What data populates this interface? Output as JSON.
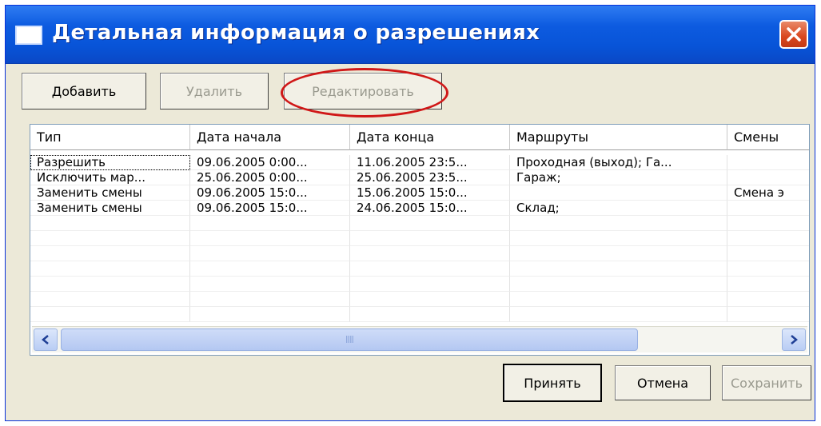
{
  "window": {
    "title": "Детальная информация о разрешениях",
    "accent_color": "#0854d8",
    "close_icon": "close-icon"
  },
  "toolbar": {
    "add_label": "Добавить",
    "delete_label": "Удалить",
    "edit_label": "Редактировать"
  },
  "grid": {
    "columns": [
      "Тип",
      "Дата начала",
      "Дата конца",
      "Маршруты",
      "Смены"
    ],
    "rows": [
      [
        "Разрешить",
        "09.06.2005 0:00...",
        "11.06.2005 23:5...",
        "Проходная (выход); Га...",
        ""
      ],
      [
        "Исключить мар...",
        "25.06.2005 0:00...",
        "25.06.2005 23:5...",
        "Гараж;",
        ""
      ],
      [
        "Заменить смены",
        "09.06.2005 15:0...",
        "15.06.2005 15:0...",
        "",
        "Смена э"
      ],
      [
        "Заменить смены",
        "09.06.2005 15:0...",
        "24.06.2005 15:0...",
        "Склад;",
        ""
      ]
    ]
  },
  "scrollbar": {
    "left_icon": "scroll-left-icon",
    "right_icon": "scroll-right-icon",
    "grip": "IIII"
  },
  "footer": {
    "accept_label": "Принять",
    "cancel_label": "Отмена",
    "save_label": "Сохранить"
  },
  "annotation": {
    "highlight_color": "#d01818"
  }
}
